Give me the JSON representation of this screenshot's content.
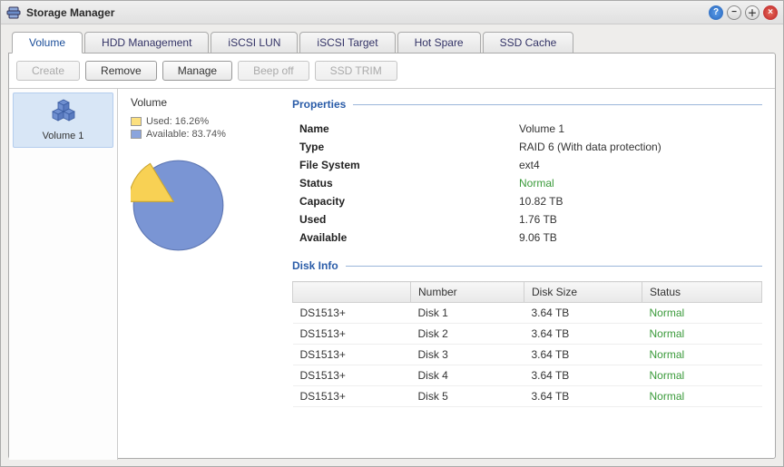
{
  "window": {
    "title": "Storage Manager"
  },
  "tabs": [
    {
      "label": "Volume",
      "active": true
    },
    {
      "label": "HDD Management"
    },
    {
      "label": "iSCSI LUN"
    },
    {
      "label": "iSCSI Target"
    },
    {
      "label": "Hot Spare"
    },
    {
      "label": "SSD Cache"
    }
  ],
  "toolbar": {
    "create": "Create",
    "remove": "Remove",
    "manage": "Manage",
    "beep": "Beep off",
    "trim": "SSD TRIM"
  },
  "sidebar": {
    "volume_label": "Volume 1"
  },
  "volume_header": "Volume",
  "legend": {
    "used": "Used: 16.26%",
    "available": "Available: 83.74%"
  },
  "sections": {
    "properties": "Properties",
    "disk_info": "Disk Info"
  },
  "properties": {
    "labels": {
      "name": "Name",
      "type": "Type",
      "fs": "File System",
      "status": "Status",
      "capacity": "Capacity",
      "used": "Used",
      "available": "Available"
    },
    "values": {
      "name": "Volume 1",
      "type": "RAID 6 (With data protection)",
      "fs": "ext4",
      "status": "Normal",
      "capacity": "10.82 TB",
      "used": "1.76 TB",
      "available": "9.06 TB"
    }
  },
  "disk_columns": {
    "model": "",
    "number": "Number",
    "size": "Disk Size",
    "status": "Status"
  },
  "disks": [
    {
      "model": "DS1513+",
      "number": "Disk 1",
      "size": "3.64 TB",
      "status": "Normal"
    },
    {
      "model": "DS1513+",
      "number": "Disk 2",
      "size": "3.64 TB",
      "status": "Normal"
    },
    {
      "model": "DS1513+",
      "number": "Disk 3",
      "size": "3.64 TB",
      "status": "Normal"
    },
    {
      "model": "DS1513+",
      "number": "Disk 4",
      "size": "3.64 TB",
      "status": "Normal"
    },
    {
      "model": "DS1513+",
      "number": "Disk 5",
      "size": "3.64 TB",
      "status": "Normal"
    }
  ],
  "chart_data": {
    "type": "pie",
    "title": "",
    "series": [
      {
        "name": "Used",
        "value": 16.26,
        "color": "#f8d154"
      },
      {
        "name": "Available",
        "value": 83.74,
        "color": "#7a95d4"
      }
    ]
  }
}
